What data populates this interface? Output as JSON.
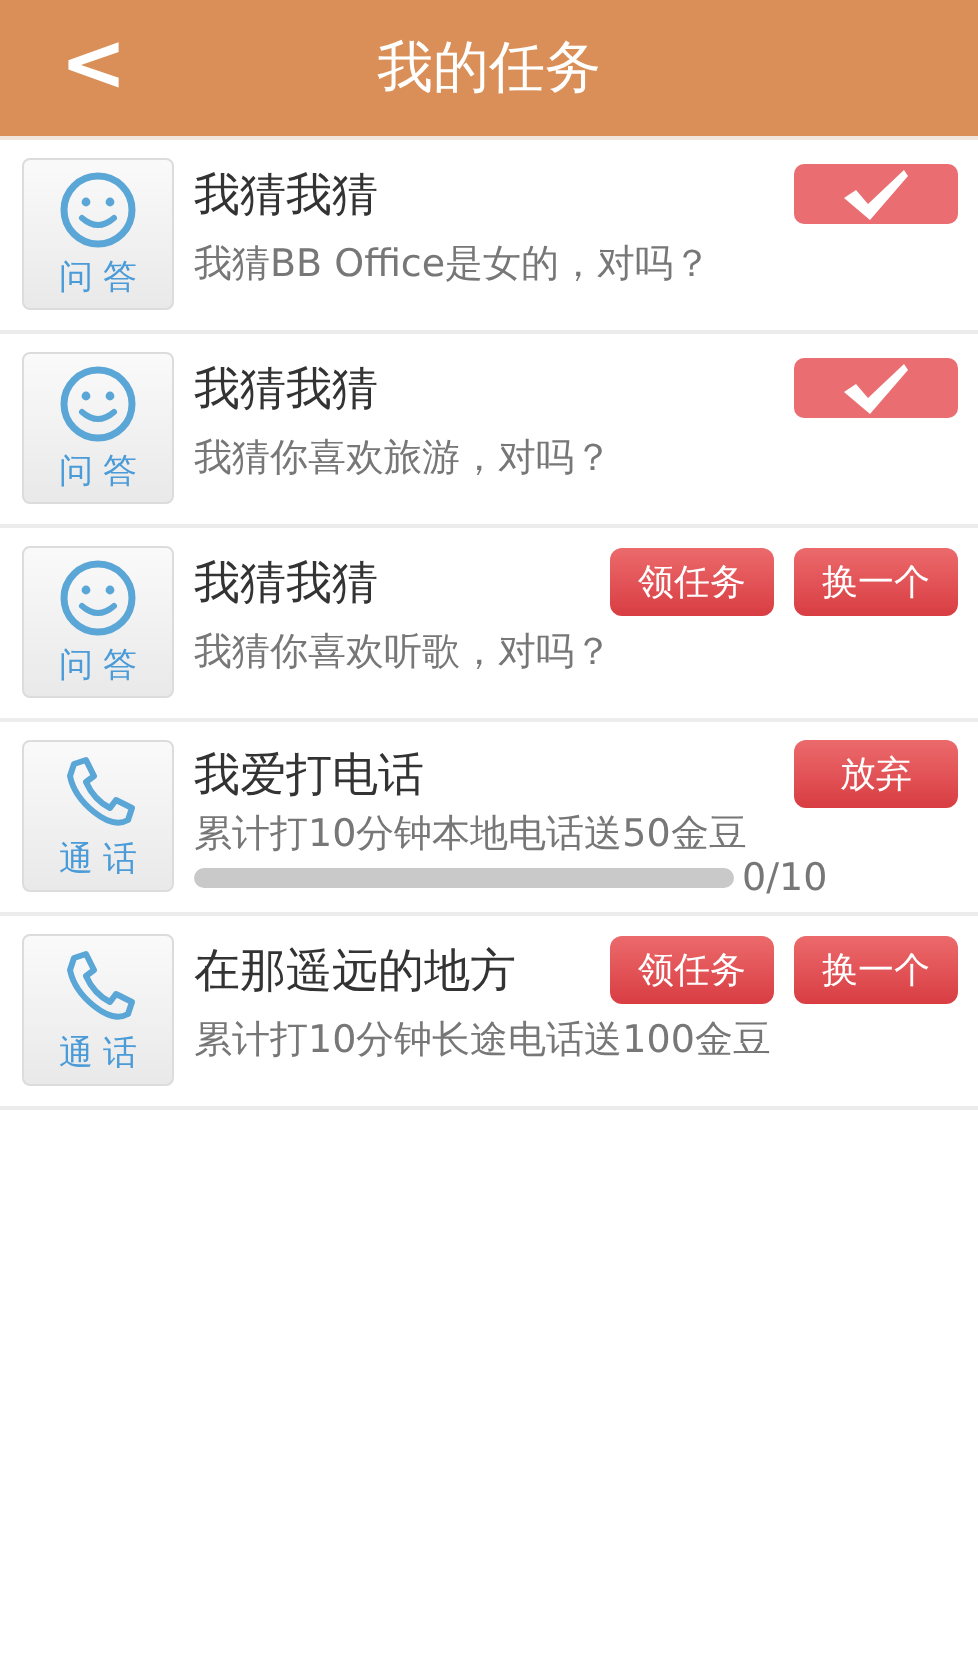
{
  "header": {
    "back": "<",
    "title": "我的任务"
  },
  "tasks": [
    {
      "kind": "qa",
      "icon_label": "问 答",
      "title": "我猜我猜",
      "description": "我猜BB Office是女的，对吗？",
      "actions": [
        {
          "kind": "done"
        }
      ]
    },
    {
      "kind": "qa",
      "icon_label": "问 答",
      "title": "我猜我猜",
      "description": "我猜你喜欢旅游，对吗？",
      "actions": [
        {
          "kind": "done"
        }
      ]
    },
    {
      "kind": "qa",
      "icon_label": "问 答",
      "title": "我猜我猜",
      "description": "我猜你喜欢听歌，对吗？",
      "actions": [
        {
          "kind": "button",
          "label": "领任务"
        },
        {
          "kind": "button",
          "label": "换一个"
        }
      ]
    },
    {
      "kind": "call",
      "icon_label": "通 话",
      "title": "我爱打电话",
      "description": "累计打10分钟本地电话送50金豆",
      "actions": [
        {
          "kind": "button",
          "label": "放弃"
        }
      ],
      "progress": {
        "level": 0,
        "reading": "0/10"
      }
    },
    {
      "kind": "call",
      "icon_label": "通 话",
      "title": "在那遥远的地方",
      "description": "累计打10分钟长途电话送100金豆",
      "actions": [
        {
          "kind": "button",
          "label": "领任务"
        },
        {
          "kind": "button",
          "label": "换一个"
        }
      ]
    }
  ]
}
